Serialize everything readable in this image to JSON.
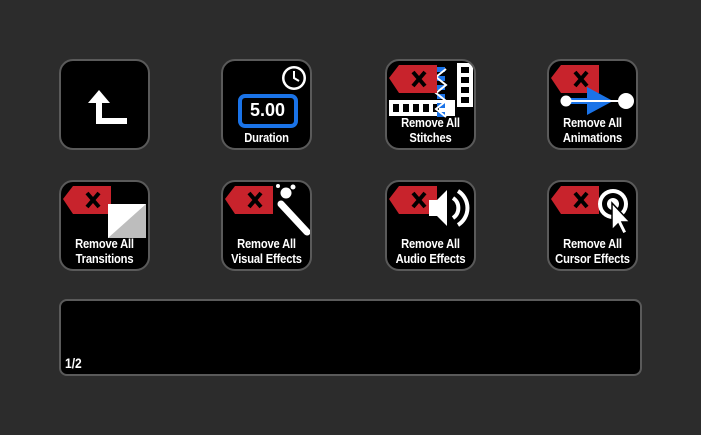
{
  "keys": {
    "back": {
      "icon": "return-arrow-icon"
    },
    "duration": {
      "value": "5.00",
      "label": "Duration",
      "icon": "clock-icon"
    },
    "remove_stitches": {
      "line1": "Remove All",
      "line2": "Stitches"
    },
    "remove_animations": {
      "line1": "Remove All",
      "line2": "Animations"
    },
    "remove_transitions": {
      "line1": "Remove All",
      "line2": "Transitions"
    },
    "remove_visual_effects": {
      "line1": "Remove All",
      "line2": "Visual Effects"
    },
    "remove_audio_effects": {
      "line1": "Remove All",
      "line2": "Audio Effects"
    },
    "remove_cursor_effects": {
      "line1": "Remove All",
      "line2": "Cursor Effects"
    }
  },
  "strip": {
    "page_indicator": "1/2"
  },
  "colors": {
    "background": "#2c2c2c",
    "key_background": "#000000",
    "key_border": "#5a5a5a",
    "remove_red": "#c8232c",
    "accent_blue": "#1a73e8"
  }
}
